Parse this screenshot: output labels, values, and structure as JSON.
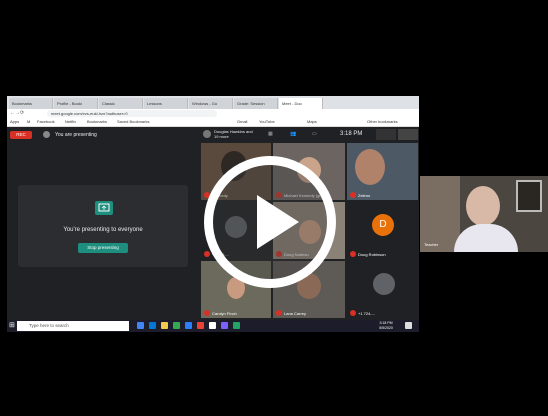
{
  "browser": {
    "tabs": [
      "Bookmarks",
      "Profile - Booki",
      "Classic",
      "Lessons",
      "Windows - Go",
      "Grade: Session",
      "Meet - Doo"
    ],
    "url": "meet.google.com/xvs-eukl-hzo?authuser=0",
    "bookmarks": [
      "Apps",
      "M",
      "Facebook",
      "Netflix",
      "Bookmarks",
      "Saved Bookmarks",
      "Gmail",
      "YouTube",
      "Maps",
      "Other bookmarks"
    ]
  },
  "meet": {
    "rec_label": "REC",
    "presenting_label": "You are presenting",
    "presenting_message": "You're presenting to everyone",
    "stop_button": "Stop presenting",
    "meeting_title": "Douglas Hawkins and 19 more",
    "time": "3:18 PM",
    "tiles": [
      {
        "name": "Kennedy"
      },
      {
        "name": "Michael Kennedy (guest)"
      },
      {
        "name": "Zeleno"
      },
      {
        "name": "+1 725-..."
      },
      {
        "name": "Doug Nadeau"
      },
      {
        "name": "Doug Robinson"
      },
      {
        "name": "Carolyn Finch"
      },
      {
        "name": "Lana Carrey"
      },
      {
        "name": "+1 724-..."
      }
    ],
    "avatar_letter": "D"
  },
  "taskbar": {
    "search_placeholder": "Type here to search",
    "clock_time": "3:18 PM",
    "clock_date": "5/5/2020"
  },
  "side_camera": {
    "label": "Teacher"
  },
  "colors": {
    "meet_bg": "#202124",
    "teal": "#1e8e7e",
    "red": "#d93025"
  }
}
